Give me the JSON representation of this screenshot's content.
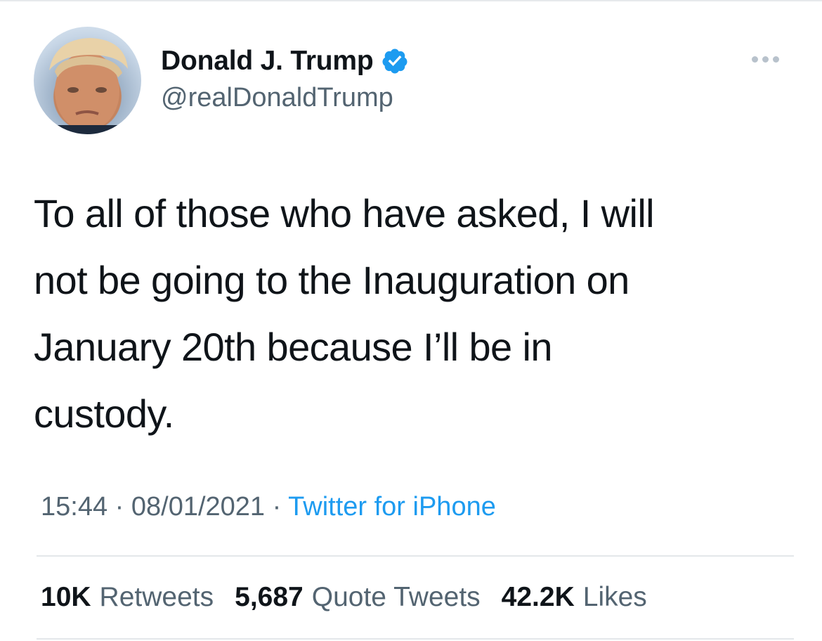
{
  "user": {
    "display_name": "Donald J. Trump",
    "handle": "@realDonaldTrump",
    "verified": true,
    "avatar_icon": "profile-photo"
  },
  "tweet": {
    "text": "To all of those who have asked, I will\nnot be going to the Inauguration on\nJanuary 20th because I’ll be in\ncustody."
  },
  "meta": {
    "time": "15:44",
    "separator": " · ",
    "date": "08/01/2021",
    "source": "Twitter for iPhone"
  },
  "stats": {
    "retweets_count": "10K",
    "retweets_label": "Retweets",
    "quotes_count": "5,687",
    "quotes_label": "Quote Tweets",
    "likes_count": "42.2K",
    "likes_label": "Likes"
  },
  "icons": {
    "verified": "verified-badge-icon",
    "more": "more-options-icon"
  },
  "colors": {
    "accent": "#1d9bf0",
    "text": "#0f1419",
    "secondary": "#536471"
  }
}
